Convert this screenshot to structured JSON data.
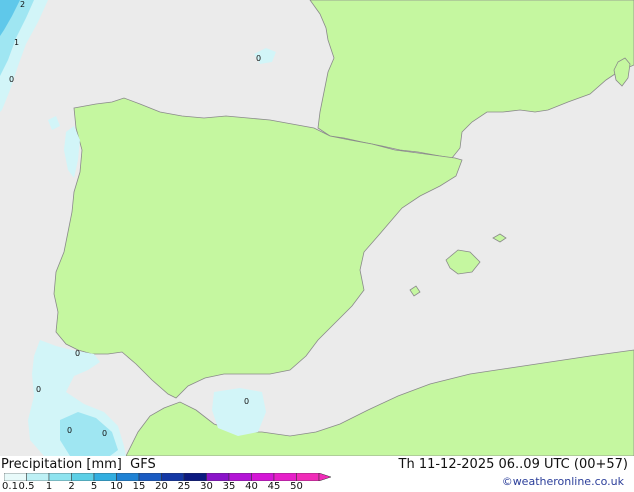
{
  "title": {
    "product": "Precipitation [mm]",
    "model": "GFS",
    "valid_time": "Th 11-12-2025 06..09 UTC (00+57)"
  },
  "credit": "©weatheronline.co.uk",
  "legend": {
    "labels": [
      "0.1",
      "0.5",
      "1",
      "2",
      "5",
      "10",
      "15",
      "20",
      "25",
      "30",
      "35",
      "40",
      "45",
      "50"
    ],
    "colors": [
      "#e8fafa",
      "#bdf0f5",
      "#8ee3ef",
      "#5ccfe6",
      "#32aee0",
      "#1f82d4",
      "#1a5bc2",
      "#1438a5",
      "#0c1a80",
      "#8a14c9",
      "#b314d6",
      "#d416d6",
      "#e61fc9",
      "#f02bb8"
    ]
  },
  "map_labels": [
    {
      "text": "2"
    },
    {
      "text": "1"
    },
    {
      "text": "0"
    },
    {
      "text": "0"
    },
    {
      "text": "0"
    },
    {
      "text": "0"
    },
    {
      "text": "0"
    },
    {
      "text": "0"
    },
    {
      "text": "0"
    }
  ],
  "colors": {
    "sea": "#ebebeb",
    "land": "#c5f7a0",
    "coast": "#8a8a8a",
    "precip_light": "#d2f5f8",
    "precip_medium": "#9fe6f2",
    "precip_heavy": "#5fc8ea"
  }
}
